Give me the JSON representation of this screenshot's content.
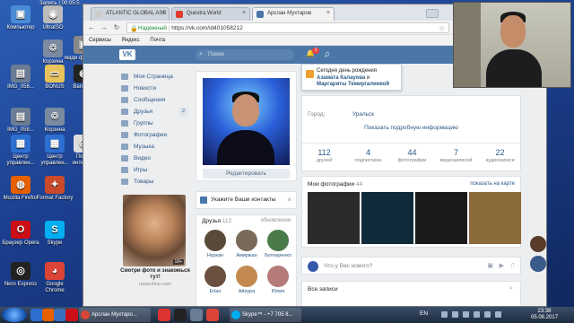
{
  "desktop": {
    "icons": [
      {
        "label": "Компьютер",
        "color": "#4a8bd6",
        "glyph": "▣"
      },
      {
        "label": "UltraISO",
        "color": "#bcbcbc",
        "glyph": "◉"
      },
      {
        "label": "Запись | 00:05:5",
        "color": "#d33",
        "glyph": "●"
      },
      {
        "label": "",
        "color": "#3a70c0",
        "glyph": ""
      },
      {
        "label": "Корзина",
        "color": "#7a8aa0",
        "glyph": "♲"
      },
      {
        "label": "Центр управлен...",
        "color": "#2d6fd0",
        "glyph": "▦"
      },
      {
        "label": "Mozilla Firefox",
        "color": "#e66000",
        "glyph": "◍"
      },
      {
        "label": "Браузер Opera",
        "color": "#cc0f16",
        "glyph": "O"
      },
      {
        "label": "Nero Express",
        "color": "#222",
        "glyph": "◎"
      },
      {
        "label": "IMG_058...",
        "color": "#6b7d95",
        "glyph": "▤"
      },
      {
        "label": "BONUS",
        "color": "#e8c25a",
        "glyph": "▭"
      },
      {
        "label": "IMG_058...",
        "color": "#6b7d95",
        "glyph": "▤"
      },
      {
        "label": "Корзина",
        "color": "#7a8aa0",
        "glyph": "♲"
      },
      {
        "label": "Bandic...",
        "color": "#222",
        "glyph": "◉"
      },
      {
        "label": "Центр управлен...",
        "color": "#2d6fd0",
        "glyph": "▦"
      },
      {
        "label": "Поиск интерн...",
        "color": "#ddd",
        "glyph": "◎"
      },
      {
        "label": "Format Factory",
        "color": "#c94a2a",
        "glyph": "✦"
      },
      {
        "label": "Skype",
        "color": "#00aff0",
        "glyph": "S"
      },
      {
        "label": "Google Chrome",
        "color": "#db4437",
        "glyph": "◕"
      },
      {
        "label": "мади формат...",
        "color": "#888",
        "glyph": "▣"
      }
    ]
  },
  "browser": {
    "tabs": [
      {
        "label": "ATLANTIC GLOBAL ASS",
        "color": "#ccc"
      },
      {
        "label": "Questra World",
        "color": "#e23a2e"
      },
      {
        "label": "Арслан Мухтаров",
        "color": "#4a76a8"
      }
    ],
    "close_glyph": "×",
    "back": "←",
    "forward": "→",
    "reload": "↻",
    "lock": "🔒",
    "secure_label": "Надежный",
    "url": "https://vk.com/id401058212",
    "star": "☆",
    "bookmarks": [
      "Сервисы",
      "Яндекс",
      "Почта"
    ]
  },
  "vk": {
    "logo": "VK",
    "search_placeholder": "Поиск",
    "notifications_count": "1",
    "bell": "🔔",
    "music": "♫",
    "nav": [
      {
        "label": "Моя Страница",
        "count": ""
      },
      {
        "label": "Новости",
        "count": ""
      },
      {
        "label": "Сообщения",
        "count": ""
      },
      {
        "label": "Друзья",
        "count": "2"
      },
      {
        "label": "Группы",
        "count": ""
      },
      {
        "label": "Фотографии",
        "count": ""
      },
      {
        "label": "Музыка",
        "count": ""
      },
      {
        "label": "Видео",
        "count": ""
      },
      {
        "label": "Игры",
        "count": ""
      },
      {
        "label": "Товары",
        "count": ""
      }
    ],
    "ad": {
      "age": "18+",
      "title": "Смотри фото и знакомься тут!",
      "site": "navechno.com"
    },
    "edit_button": "Редактировать",
    "phone_banner": "Укажите Ваши контакты",
    "friends": {
      "title": "Друзья",
      "count": "112",
      "updates": "обновления",
      "list": [
        {
          "name": "Нуркан",
          "color": "#5a4a3a"
        },
        {
          "name": "Амиржан",
          "color": "#7a6a5a"
        },
        {
          "name": "Ботнаренко",
          "color": "#4a7a4a"
        },
        {
          "name": "Erlan",
          "color": "#6a5040"
        },
        {
          "name": "Айнура",
          "color": "#c28a50"
        },
        {
          "name": "Юлия",
          "color": "#b57a7a"
        }
      ]
    },
    "birthday": {
      "prefix": "Сегодня день рождения",
      "person1": "Азамата Калауова",
      "and": "и",
      "person2": "Маргариты Темиргалиевой"
    },
    "city_label": "Город:",
    "city_value": "Уральск",
    "more_info": "Показать подробную информацию",
    "counters": [
      {
        "num": "112",
        "label": "друзей"
      },
      {
        "num": "4",
        "label": "подписчика"
      },
      {
        "num": "44",
        "label": "фотографии"
      },
      {
        "num": "7",
        "label": "видеозаписей"
      },
      {
        "num": "22",
        "label": "аудиозаписи"
      }
    ],
    "photos": {
      "title": "Мои фотографии",
      "count": "44",
      "map_link": "показать на карте",
      "thumbs": [
        "#2b2b2b",
        "#0f2a3a",
        "#1a1a1a",
        "#8a6a3a"
      ]
    },
    "post_placeholder": "Что у Вас нового?",
    "all_posts": "Все записи",
    "side_avatars": [
      "#5a3c2a",
      "#3a5a8a"
    ]
  },
  "taskbar": {
    "items": [
      {
        "label": "Арслан Мухтаро...",
        "color": "#db4437"
      },
      {
        "label": "Skype™ - +7 705 8...",
        "color": "#00aff0"
      }
    ],
    "pins": [
      "#2d6fd0",
      "#e66000",
      "#3a70c0",
      "#cc0f16",
      "#d33",
      "#222",
      "#6b7d95",
      "#db4437"
    ],
    "lang": "EN",
    "time": "23:38",
    "date": "05.08.2017"
  }
}
